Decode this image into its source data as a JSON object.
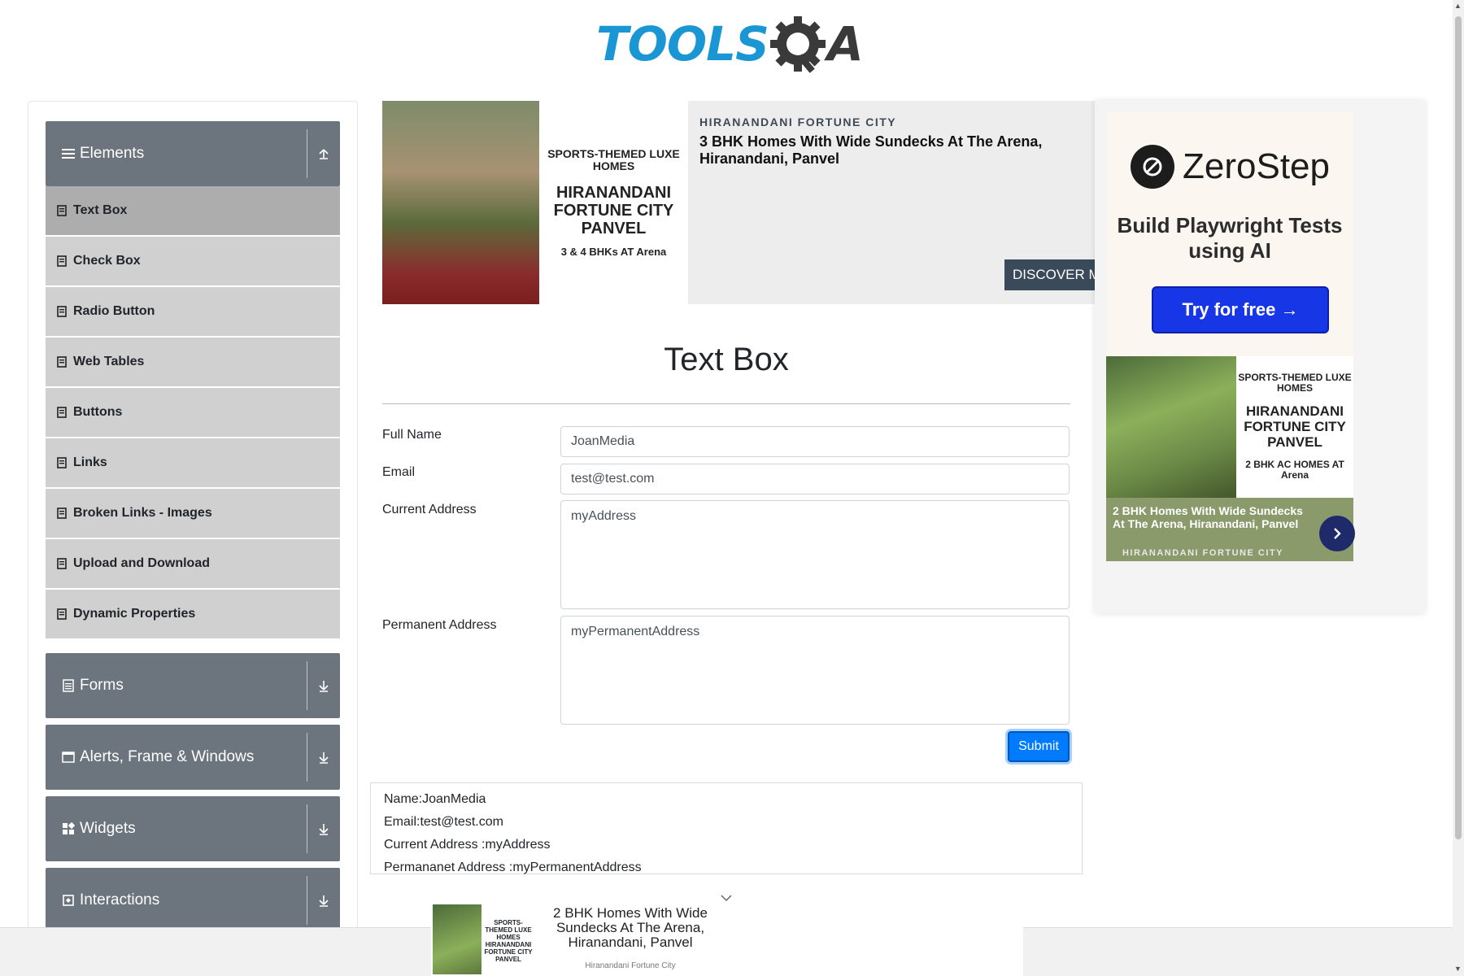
{
  "header": {
    "logo_text": "TOOLS",
    "logo_qa": "QA"
  },
  "sidebar": {
    "groups": [
      {
        "title": "Elements",
        "icon": "menu-icon",
        "expanded": true,
        "items": [
          {
            "label": "Text Box",
            "active": true
          },
          {
            "label": "Check Box"
          },
          {
            "label": "Radio Button"
          },
          {
            "label": "Web Tables"
          },
          {
            "label": "Buttons"
          },
          {
            "label": "Links"
          },
          {
            "label": "Broken Links - Images"
          },
          {
            "label": "Upload and Download"
          },
          {
            "label": "Dynamic Properties"
          }
        ]
      },
      {
        "title": "Forms",
        "icon": "form-icon"
      },
      {
        "title": "Alerts, Frame & Windows",
        "icon": "window-icon"
      },
      {
        "title": "Widgets",
        "icon": "widgets-icon"
      },
      {
        "title": "Interactions",
        "icon": "interactions-icon"
      }
    ]
  },
  "top_ad": {
    "img_line1": "SPORTS-THEMED LUXE HOMES",
    "img_line2": "HIRANANDANI FORTUNE CITY PANVEL",
    "img_line3": "3 & 4 BHKs AT Arena",
    "brand": "HIRANANDANI FORTUNE CITY",
    "headline": "3 BHK Homes With Wide Sundecks At The Arena, Hiranandani, Panvel",
    "button": "DISCOVER MORE"
  },
  "right_ad": {
    "logo": "ZeroStep",
    "tagline": "Build Playwright Tests using AI",
    "cta": "Try for free →",
    "card_line1": "SPORTS-THEMED LUXE HOMES",
    "card_line2": "HIRANANDANI FORTUNE CITY PANVEL",
    "card_line3": "2 BHK AC HOMES AT Arena",
    "bottom_text": "2 BHK Homes With Wide Sundecks At The Arena, Hiranandani, Panvel",
    "bottom_brand": "HIRANANDANI FORTUNE CITY"
  },
  "form": {
    "title": "Text Box",
    "full_name_label": "Full Name",
    "full_name_value": "JoanMedia",
    "email_label": "Email",
    "email_value": "test@test.com",
    "current_address_label": "Current Address",
    "current_address_value": "myAddress",
    "permanent_address_label": "Permanent Address",
    "permanent_address_value": "myPermanentAddress",
    "submit_label": "Submit"
  },
  "output": {
    "name": "Name:JoanMedia",
    "email": "Email:test@test.com",
    "current": "Current Address :myAddress",
    "permanent": "Permananet Address :myPermanentAddress"
  },
  "bottom_ad": {
    "img_text": "SPORTS-THEMED LUXE HOMES HIRANANDANI FORTUNE CITY PANVEL",
    "headline": "2 BHK Homes With Wide Sundecks At The Arena, Hiranandani, Panvel",
    "brand": "Hiranandani Fortune City"
  },
  "colors": {
    "accent": "#007bff",
    "sidebar_header": "#6c757d",
    "menu_item": "#d0d0d0",
    "menu_item_active": "#adadad",
    "logo_blue": "#1a96d4"
  }
}
